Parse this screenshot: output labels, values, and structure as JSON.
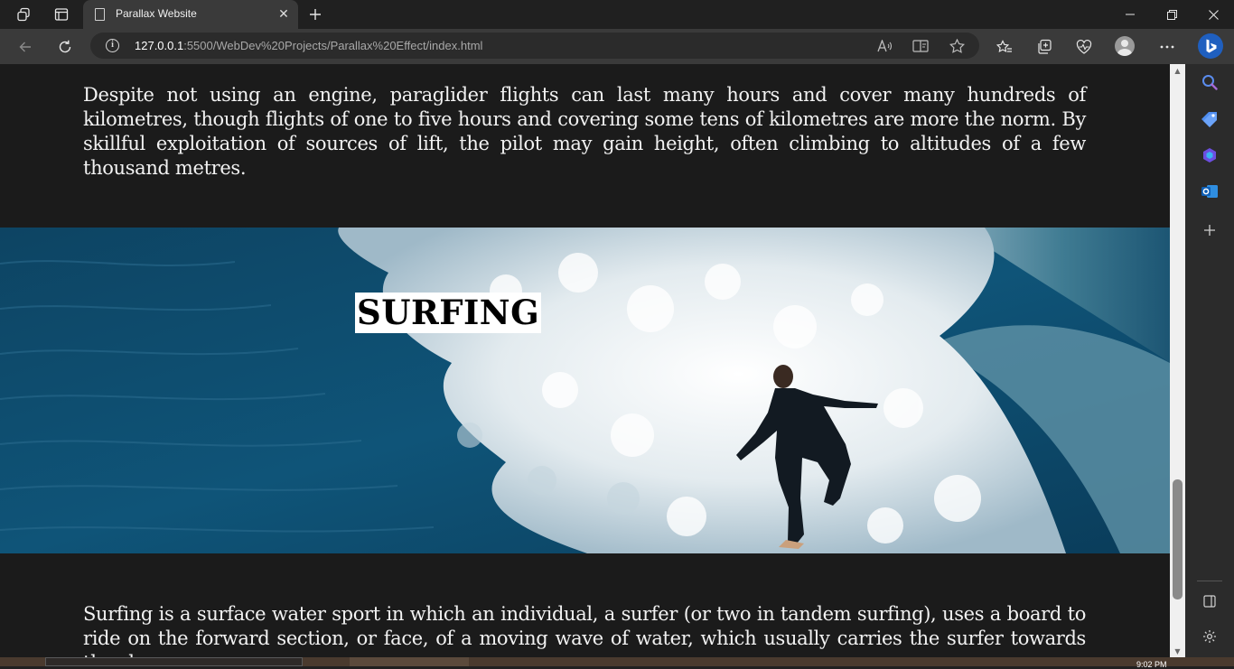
{
  "browser": {
    "tab_title": "Parallax Website",
    "url_host": "127.0.0.1",
    "url_rest": ":5500/WebDev%20Projects/Parallax%20Effect/index.html"
  },
  "page": {
    "paragraph_paragliding": "Despite not using an engine, paraglider flights can last many hours and cover many hundreds of kilometres, though flights of one to five hours and covering some tens of kilometres are more the norm. By skillful exploitation of sources of lift, the pilot may gain height, often climbing to altitudes of a few thousand metres.",
    "surfing_heading": "SURFING",
    "paragraph_surfing": "Surfing is a surface water sport in which an individual, a surfer (or two in tandem surfing), uses a board to ride on the forward section, or face, of a moving wave of water, which usually carries the surfer towards the shore."
  },
  "taskbar": {
    "clock": "9:02 PM"
  },
  "colors": {
    "page_background": "#1b1b1b",
    "paragraph_text": "#f2f2f2",
    "heading_background": "#ffffff",
    "ocean": "#0e4a6c"
  }
}
